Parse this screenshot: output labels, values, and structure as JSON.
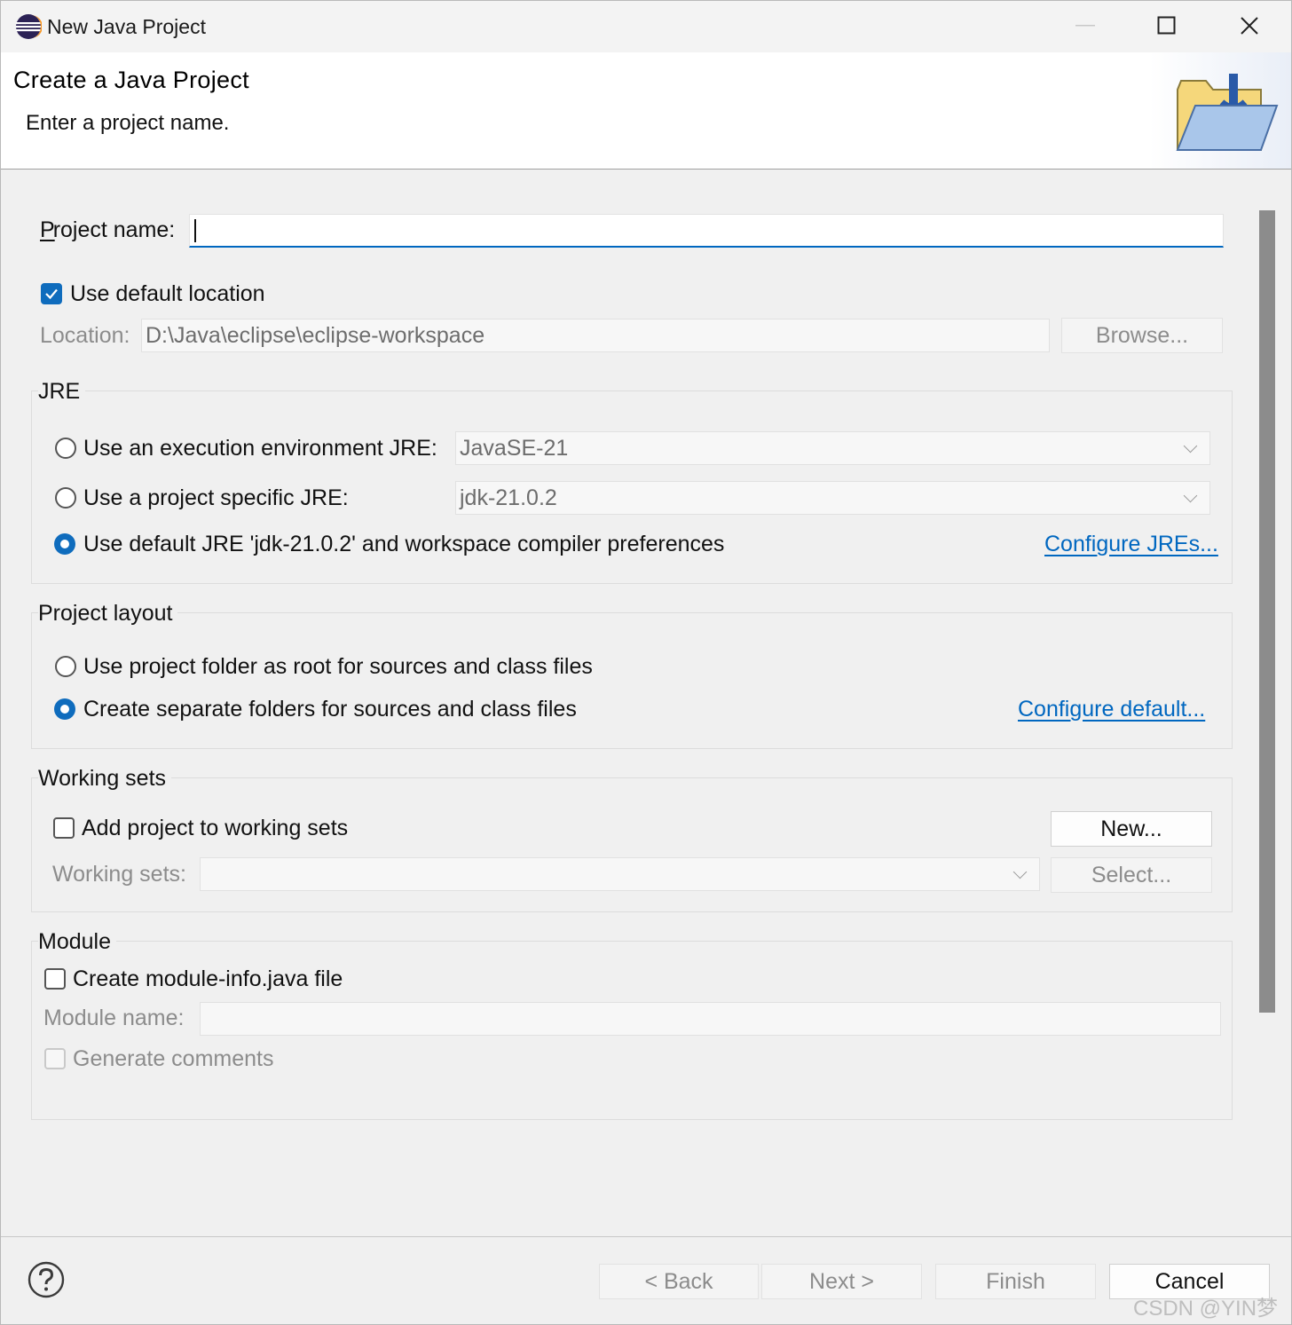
{
  "window": {
    "title": "New Java Project",
    "minimize_icon": "minimize-icon",
    "maximize_icon": "maximize-icon",
    "close_icon": "close-icon"
  },
  "banner": {
    "title": "Create a Java Project",
    "message": "Enter a project name.",
    "image_icon": "java-project-folder-icon"
  },
  "project_name": {
    "label": "Project name:",
    "value": ""
  },
  "location": {
    "use_default_label": "Use default location",
    "use_default_checked": true,
    "location_label": "Location:",
    "location_value": "D:\\Java\\eclipse\\eclipse-workspace",
    "browse_label": "Browse..."
  },
  "jre": {
    "group_title": "JRE",
    "options": [
      {
        "label": "Use an execution environment JRE:",
        "selected": false,
        "combo_value": "JavaSE-21"
      },
      {
        "label": "Use a project specific JRE:",
        "selected": false,
        "combo_value": "jdk-21.0.2"
      },
      {
        "label": "Use default JRE 'jdk-21.0.2' and workspace compiler preferences",
        "selected": true
      }
    ],
    "configure_link": "Configure JREs..."
  },
  "layout": {
    "group_title": "Project layout",
    "options": [
      {
        "label": "Use project folder as root for sources and class files",
        "selected": false
      },
      {
        "label": "Create separate folders for sources and class files",
        "selected": true
      }
    ],
    "configure_link": "Configure default..."
  },
  "working_sets": {
    "group_title": "Working sets",
    "add_label": "Add project to working sets",
    "add_checked": false,
    "new_label": "New...",
    "sets_label": "Working sets:",
    "sets_value": "",
    "select_label": "Select..."
  },
  "module": {
    "group_title": "Module",
    "create_label": "Create module-info.java file",
    "create_checked": false,
    "name_label": "Module name:",
    "name_value": "",
    "comments_label": "Generate comments",
    "comments_checked": false
  },
  "footer": {
    "help_icon": "help-icon",
    "back_label": "< Back",
    "next_label": "Next >",
    "finish_label": "Finish",
    "cancel_label": "Cancel",
    "watermark": "CSDN @YIN梦"
  }
}
